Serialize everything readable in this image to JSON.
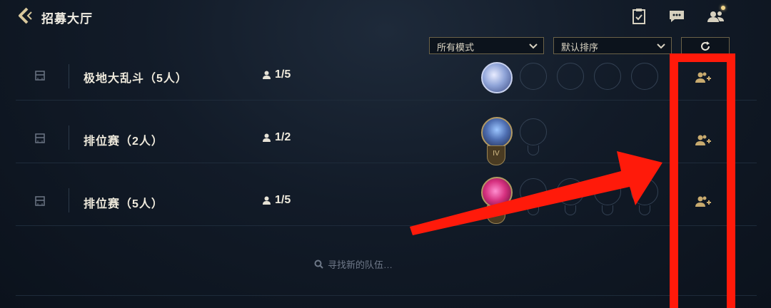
{
  "header": {
    "title": "招募大厅"
  },
  "filters": {
    "mode_select": "所有模式",
    "sort_select": "默认排序"
  },
  "rows": [
    {
      "mode": "极地大乱斗（5人）",
      "count": "1/5",
      "total_slots": 5,
      "avatar": "poro-icon"
    },
    {
      "mode": "排位赛（2人）",
      "count": "1/2",
      "total_slots": 2,
      "avatar": "champion-icon",
      "rank": "IV"
    },
    {
      "mode": "排位赛（5人）",
      "count": "1/5",
      "total_slots": 5,
      "avatar": "heart-icon"
    }
  ],
  "search": {
    "placeholder": "寻找新的队伍…"
  },
  "colors": {
    "accent_gold": "#c8aa6e",
    "annotation_red": "#ff1a0a"
  }
}
